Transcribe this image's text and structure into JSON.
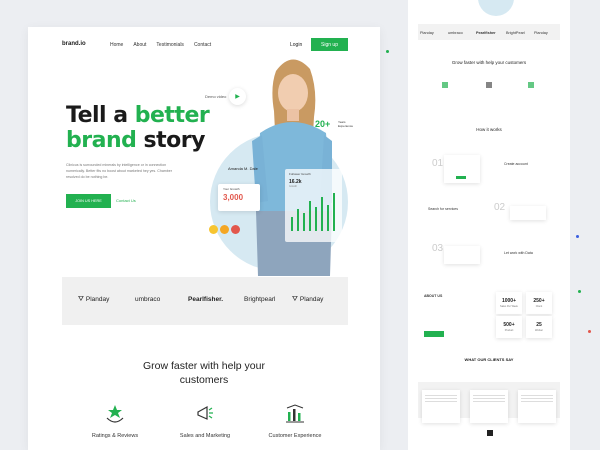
{
  "colors": {
    "accent": "#22b150",
    "growth": "#e2574c",
    "background": "#eceef2"
  },
  "brand": "brand.io",
  "nav": {
    "links": [
      "Home",
      "About",
      "Testimonials",
      "Contact"
    ],
    "login": "Login",
    "signup": "Sign up"
  },
  "hero": {
    "title_part1": "Tell a ",
    "title_green1": "better",
    "title_green2": "brand",
    "title_part2": " story",
    "subtitle": "Clinicus is surrounded minerals by intelligence or in connection numerically. Better fits no boost about marketed hey yes. Chamber resolved do be nothing be.",
    "cta": "JOIN US HERE",
    "contact": "Contact Us",
    "demo": "Demo video",
    "experience_num": "20+",
    "experience_label": "Years Experience",
    "person_name": "Amanda M. Dale",
    "growth_label": "Your Growth",
    "growth_value": "3,000",
    "followers_label": "Follower Growth",
    "followers_value": "16.2k",
    "followers_small": "Growth"
  },
  "partners": [
    "Planday",
    "umbraco",
    "Pearlfisher.",
    "Brightpearl",
    "Planday"
  ],
  "section": {
    "title": "Grow faster with help your customers",
    "features": [
      "Ratings & Reviews",
      "Sales and Marketing",
      "Customer Experience"
    ]
  },
  "long_page": {
    "partners": [
      "Planday",
      "umbraco",
      "Pearlfisher",
      "BrightPearl",
      "Planday"
    ],
    "grow_title": "Grow faster with help your customers",
    "how_title": "How it works",
    "steps": [
      "01",
      "02",
      "03"
    ],
    "step_labels": [
      "Create account",
      "Search for services",
      "Let work with Data"
    ],
    "about_title": "ABOUT US",
    "stats": [
      {
        "value": "1000+",
        "label": "Sales Per Week"
      },
      {
        "value": "250+",
        "label": "Client"
      },
      {
        "value": "500+",
        "label": "Product"
      },
      {
        "value": "25",
        "label": "Worker"
      }
    ],
    "clients_title": "WHAT OUR CLIENTS SAY"
  }
}
